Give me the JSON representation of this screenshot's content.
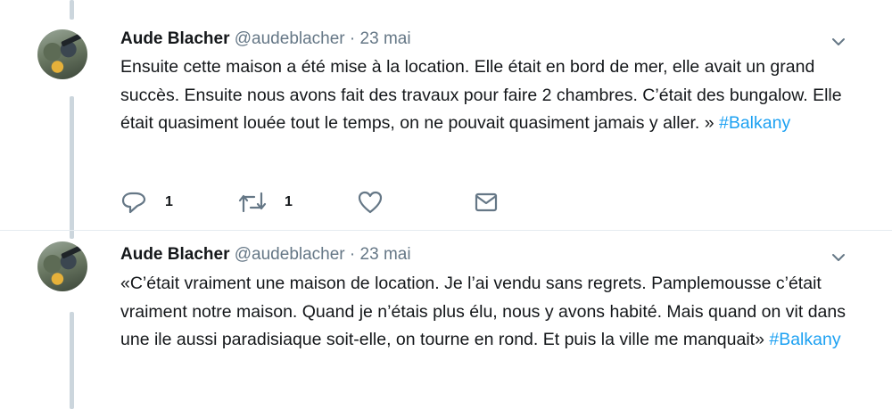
{
  "tweets": [
    {
      "author_name": "Aude Blacher",
      "handle": "@audeblacher",
      "separator": "·",
      "date": "23 mai",
      "avatar_icon": "profile-photo",
      "text": "Ensuite cette maison a été mise à la location. Elle était en bord de mer, elle avait un grand succès. Ensuite nous avons fait des travaux pour faire 2 chambres. C’était des bungalow. Elle était quasiment louée tout le temps, on ne pouvait quasiment jamais y aller. » ",
      "hashtag": "#Balkany",
      "reply_count": "1",
      "retweet_count": "1"
    },
    {
      "author_name": "Aude Blacher",
      "handle": "@audeblacher",
      "separator": "·",
      "date": "23 mai",
      "avatar_icon": "profile-photo",
      "text": "«C’était vraiment une maison de location. Je l’ai vendu sans regrets. Pamplemousse c’était vraiment notre maison. Quand je n’étais plus élu, nous y avons habité. Mais quand on vit dans une ile aussi paradisiaque soit-elle, on tourne en rond. Et puis la ville me manquait» ",
      "hashtag": "#Balkany"
    }
  ],
  "colors": {
    "link": "#1da1f2",
    "secondary_text": "#657786",
    "icon": "#657786",
    "thread_line": "#ccd6dd"
  }
}
